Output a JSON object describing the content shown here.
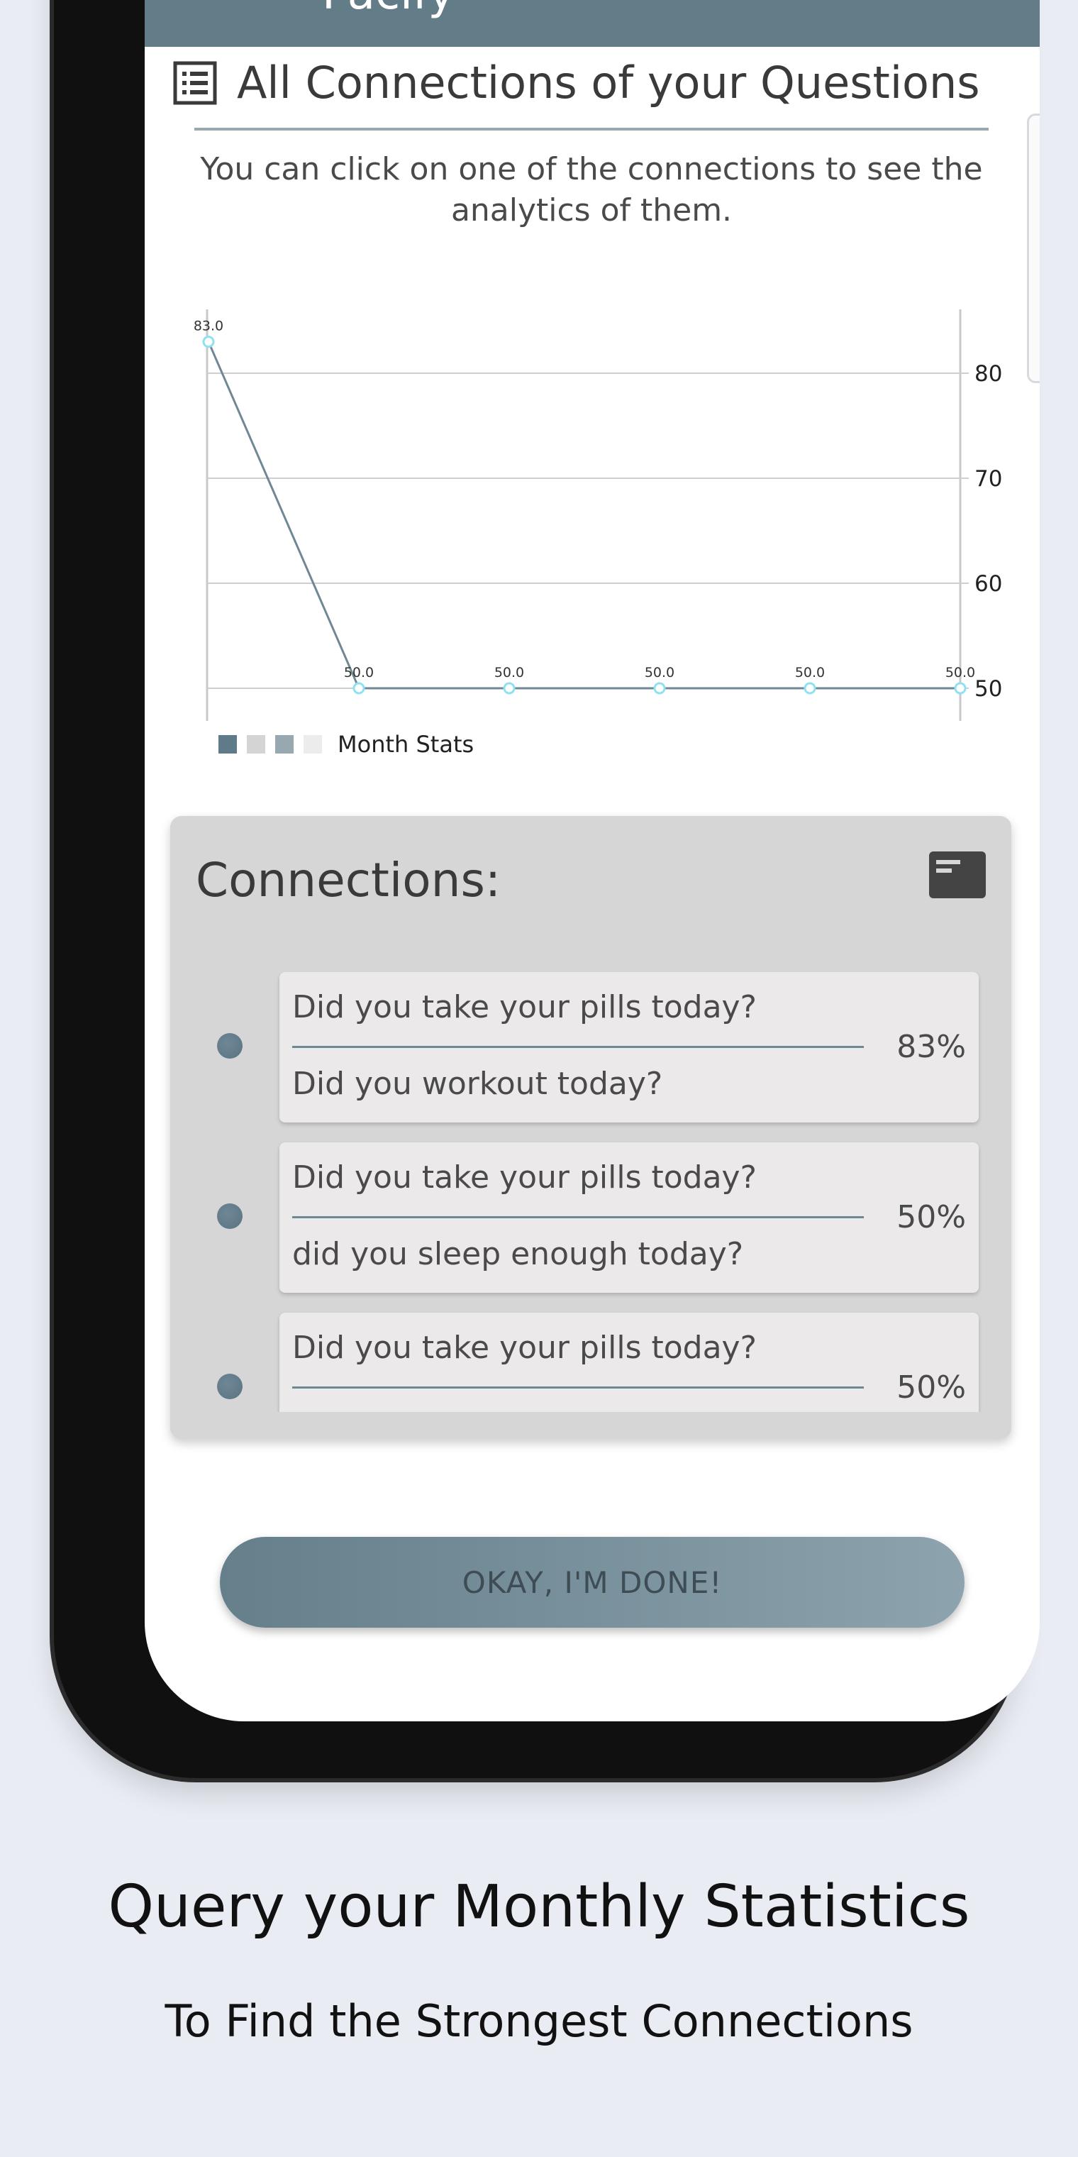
{
  "app": {
    "title_partial": "Pacify"
  },
  "header": {
    "title": "All Connections of your Questions",
    "subtitle": "You can click on one of the connections to see the analytics of them."
  },
  "chart_data": {
    "type": "line",
    "x": [
      1,
      2,
      3,
      4,
      5,
      6
    ],
    "series": [
      {
        "name": "Month Stats",
        "values": [
          83.0,
          50.0,
          50.0,
          50.0,
          50.0,
          50.0
        ]
      }
    ],
    "y_ticks": [
      80,
      70,
      60,
      50
    ],
    "data_labels": [
      "83.0",
      "50.0",
      "50.0",
      "50.0",
      "50.0",
      "50.0"
    ],
    "legend": "bottom-left",
    "grid": true,
    "line_color": "#6f8894",
    "point_color": "#8fe1f0",
    "legend_colors": [
      "#5f7b89",
      "#d4d4d4",
      "#97a8b1",
      "#ececec"
    ]
  },
  "connections": {
    "title": "Connections:",
    "items": [
      {
        "q1": "Did you take your pills today?",
        "q2": "Did you workout today?",
        "pct": "83%"
      },
      {
        "q1": "Did you take your pills today?",
        "q2": "did you sleep enough today?",
        "pct": "50%"
      },
      {
        "q1": "Did you take your pills today?",
        "q2": "",
        "pct": "50%"
      }
    ]
  },
  "button": {
    "label": "OKAY, I'M DONE!"
  },
  "captions": {
    "headline": "Query your Monthly Statistics",
    "subline": "To Find the Strongest Connections"
  }
}
